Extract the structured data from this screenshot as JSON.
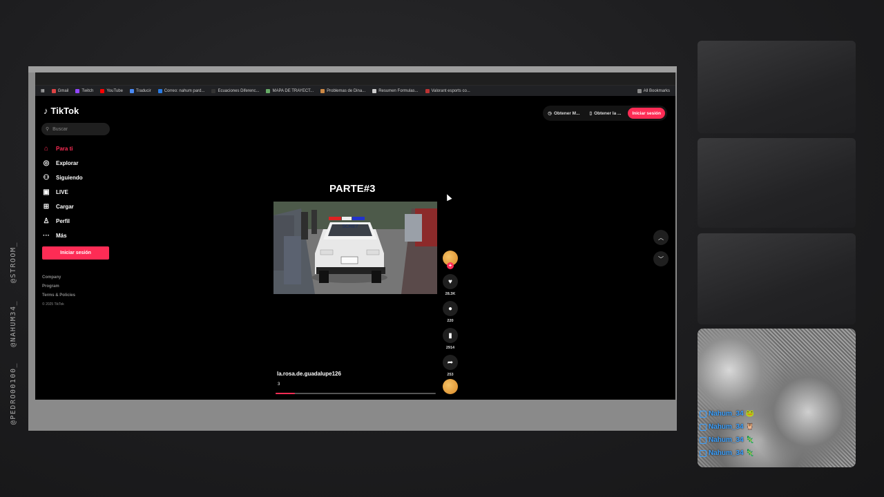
{
  "overlay": {
    "handles": [
      "@STROOM_",
      "@NAHUM34_",
      "@PEDRO00100_"
    ]
  },
  "bookmarks": [
    {
      "label": "Gmail"
    },
    {
      "label": "Twitch"
    },
    {
      "label": "YouTube"
    },
    {
      "label": "Traducir"
    },
    {
      "label": "Correo: nahum pard..."
    },
    {
      "label": "Ecuaciones Diferenc..."
    },
    {
      "label": "MAPA DE TRAYECT..."
    },
    {
      "label": "Problemas de Dina..."
    },
    {
      "label": "Resumen Formulas..."
    },
    {
      "label": "Valorant esports co..."
    }
  ],
  "bookmarks_all": "All Bookmarks",
  "app": {
    "logo": "TikTok",
    "search_placeholder": "Buscar",
    "nav": [
      {
        "label": "Para ti",
        "icon": "home-icon"
      },
      {
        "label": "Explorar",
        "icon": "compass-icon"
      },
      {
        "label": "Siguiendo",
        "icon": "following-icon"
      },
      {
        "label": "LIVE",
        "icon": "live-icon"
      },
      {
        "label": "Cargar",
        "icon": "upload-icon"
      },
      {
        "label": "Perfil",
        "icon": "profile-icon"
      },
      {
        "label": "Más",
        "icon": "more-icon"
      }
    ],
    "login_side": "Iniciar sesión",
    "footer": [
      "Company",
      "Program",
      "Terms & Policies"
    ],
    "copyright": "© 2025 TikTok",
    "top_buttons": {
      "get_coins": "Obtener M...",
      "get_app": "Obtener la ...",
      "login": "Iniciar sesión"
    },
    "video": {
      "title": "PARTE#3",
      "username": "la.rosa.de.guadalupe126",
      "description": "3",
      "progress": 0.12,
      "plate": "SCRE7"
    },
    "actions": {
      "likes": "28.3K",
      "comments": "220",
      "saves": "2914",
      "shares": "253"
    }
  },
  "chat": [
    {
      "name": "Nahum_34",
      "emoji": "🐸"
    },
    {
      "name": "Nahum_34",
      "emoji": "🦉"
    },
    {
      "name": "Nahum_34",
      "emoji": "🦎"
    },
    {
      "name": "Nahum_34",
      "emoji": "🦎"
    }
  ],
  "colors": {
    "accent": "#fe2c55",
    "chat_name": "#3aa0ff"
  }
}
